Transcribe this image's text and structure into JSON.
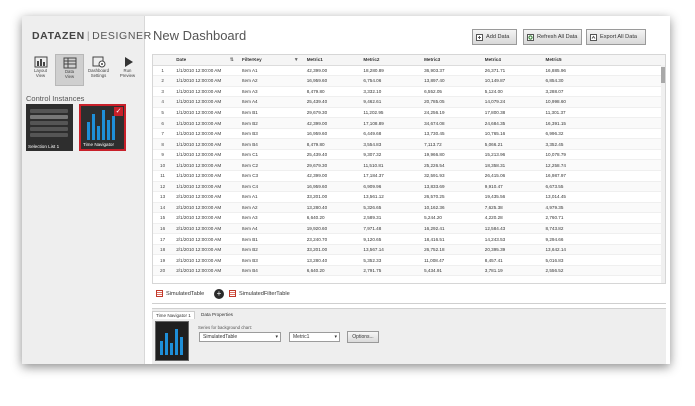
{
  "brand": {
    "part1": "DATAZEN",
    "part2": "DESIGNER"
  },
  "modes": [
    {
      "id": "layout-view",
      "line1": "Layout",
      "line2": "View",
      "active": false
    },
    {
      "id": "data-view",
      "line1": "Data",
      "line2": "View",
      "active": true
    },
    {
      "id": "dashboard-settings",
      "line1": "Dashboard",
      "line2": "Settings",
      "active": false
    },
    {
      "id": "run-preview",
      "line1": "Run",
      "line2": "Preview",
      "active": false
    }
  ],
  "control_instances": {
    "title": "Control Instances",
    "items": [
      {
        "label": "Selection List 1",
        "rows": [
          "Selection Item",
          "Selection Item",
          "Selection Item",
          "Selection Item",
          "Selection Item"
        ]
      },
      {
        "label": "Time Navigator",
        "selected": true
      }
    ]
  },
  "main": {
    "title": "New Dashboard",
    "buttons": {
      "add": "Add Data",
      "refresh": "Refresh All Data",
      "export": "Export All Data"
    }
  },
  "table": {
    "columns": [
      "",
      "Date",
      "FilterKey",
      "Metric1",
      "Metric2",
      "Metric3",
      "Metric4",
      "Metric5"
    ],
    "rows": [
      [
        "1",
        "1/1/2010 12:00:00 AM",
        "Item A1",
        "42,399.00",
        "18,280.89",
        "36,903.37",
        "26,371.71",
        "16,885.96"
      ],
      [
        "2",
        "1/1/2010 12:00:00 AM",
        "Item A2",
        "16,959.60",
        "6,754.06",
        "13,897.40",
        "10,149.87",
        "6,854.30"
      ],
      [
        "3",
        "1/1/2010 12:00:00 AM",
        "Item A3",
        "8,479.80",
        "3,332.10",
        "6,552.05",
        "5,124.00",
        "3,288.07"
      ],
      [
        "4",
        "1/1/2010 12:00:00 AM",
        "Item A4",
        "25,439.40",
        "9,462.61",
        "20,785.05",
        "14,079.24",
        "10,998.60"
      ],
      [
        "5",
        "1/1/2010 12:00:00 AM",
        "Item B1",
        "29,679.30",
        "11,202.95",
        "24,256.19",
        "17,800.38",
        "11,301.37"
      ],
      [
        "6",
        "1/1/2010 12:00:00 AM",
        "Item B2",
        "42,399.00",
        "17,108.89",
        "34,674.08",
        "24,684.35",
        "16,391.15"
      ],
      [
        "7",
        "1/1/2010 12:00:00 AM",
        "Item B3",
        "16,959.60",
        "6,449.68",
        "13,730.45",
        "10,765.16",
        "6,996.32"
      ],
      [
        "8",
        "1/1/2010 12:00:00 AM",
        "Item B4",
        "8,479.80",
        "3,554.83",
        "7,113.72",
        "5,066.21",
        "3,352.45"
      ],
      [
        "9",
        "1/1/2010 12:00:00 AM",
        "Item C1",
        "25,439.40",
        "9,307.32",
        "19,966.80",
        "15,213.96",
        "10,078.79"
      ],
      [
        "10",
        "1/1/2010 12:00:00 AM",
        "Item C2",
        "29,679.30",
        "11,510.81",
        "25,226.54",
        "18,358.31",
        "12,258.74"
      ],
      [
        "11",
        "1/1/2010 12:00:00 AM",
        "Item C3",
        "42,399.00",
        "17,184.37",
        "32,591.93",
        "26,415.06",
        "16,987.97"
      ],
      [
        "12",
        "1/1/2010 12:00:00 AM",
        "Item C4",
        "16,959.60",
        "6,909.96",
        "13,833.69",
        "9,910.47",
        "6,673.55"
      ],
      [
        "13",
        "2/1/2010 12:00:00 AM",
        "Item A1",
        "33,201.00",
        "13,561.12",
        "26,570.25",
        "19,435.56",
        "13,014.45"
      ],
      [
        "14",
        "2/1/2010 12:00:00 AM",
        "Item A2",
        "13,280.40",
        "5,326.65",
        "10,162.36",
        "7,625.38",
        "4,979.35"
      ],
      [
        "15",
        "2/1/2010 12:00:00 AM",
        "Item A3",
        "6,640.20",
        "2,589.31",
        "5,244.20",
        "4,220.28",
        "2,760.71"
      ],
      [
        "16",
        "2/1/2010 12:00:00 AM",
        "Item A4",
        "19,920.60",
        "7,971.48",
        "16,292.41",
        "12,584.43",
        "8,743.82"
      ],
      [
        "17",
        "2/1/2010 12:00:00 AM",
        "Item B1",
        "23,240.70",
        "9,120.65",
        "18,416.51",
        "14,243.53",
        "9,294.66"
      ],
      [
        "18",
        "2/1/2010 12:00:00 AM",
        "Item B2",
        "33,201.00",
        "13,567.14",
        "26,752.18",
        "20,395.39",
        "13,642.14"
      ],
      [
        "19",
        "2/1/2010 12:00:00 AM",
        "Item B3",
        "13,280.40",
        "5,352.33",
        "11,008.47",
        "8,457.41",
        "5,016.83"
      ],
      [
        "20",
        "2/1/2010 12:00:00 AM",
        "Item B4",
        "6,640.20",
        "2,791.75",
        "5,434.91",
        "3,781.19",
        "2,556.52"
      ]
    ]
  },
  "tabs": {
    "tab1": "SimulatedTable",
    "tab2": "SimulatedFilterTable",
    "add": "+"
  },
  "properties": {
    "tab1": "Time Navigator 1",
    "tab2": "Data Properties",
    "series_label": "Series for background chart:",
    "table_select": "SimulatedTable",
    "metric_select": "Metric1",
    "options_button": "Options..."
  }
}
